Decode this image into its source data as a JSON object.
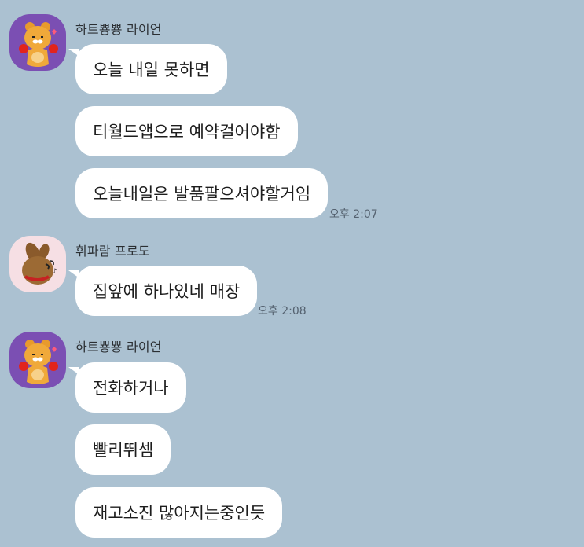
{
  "colors": {
    "background": "#abc1d1",
    "bubble": "#ffffff",
    "purple_avatar": "#7b4fb3",
    "pink_avatar": "#f6dfe4"
  },
  "groups": [
    {
      "sender": "하트뿅뿅 라이언",
      "avatar_icon": "ryan-character-icon",
      "messages": [
        {
          "text": "오늘 내일 못하면"
        },
        {
          "text": "티월드앱으로 예약걸어야함"
        },
        {
          "text": "오늘내일은 발품팔으셔야할거임",
          "time": "오후 2:07"
        }
      ]
    },
    {
      "sender": "휘파람 프로도",
      "avatar_icon": "frodo-character-icon",
      "messages": [
        {
          "text": "집앞에 하나있네 매장",
          "time": "오후 2:08"
        }
      ]
    },
    {
      "sender": "하트뿅뿅 라이언",
      "avatar_icon": "ryan-character-icon",
      "messages": [
        {
          "text": "전화하거나"
        },
        {
          "text": "빨리뛰셈"
        },
        {
          "text": "재고소진 많아지는중인듯"
        }
      ]
    }
  ]
}
